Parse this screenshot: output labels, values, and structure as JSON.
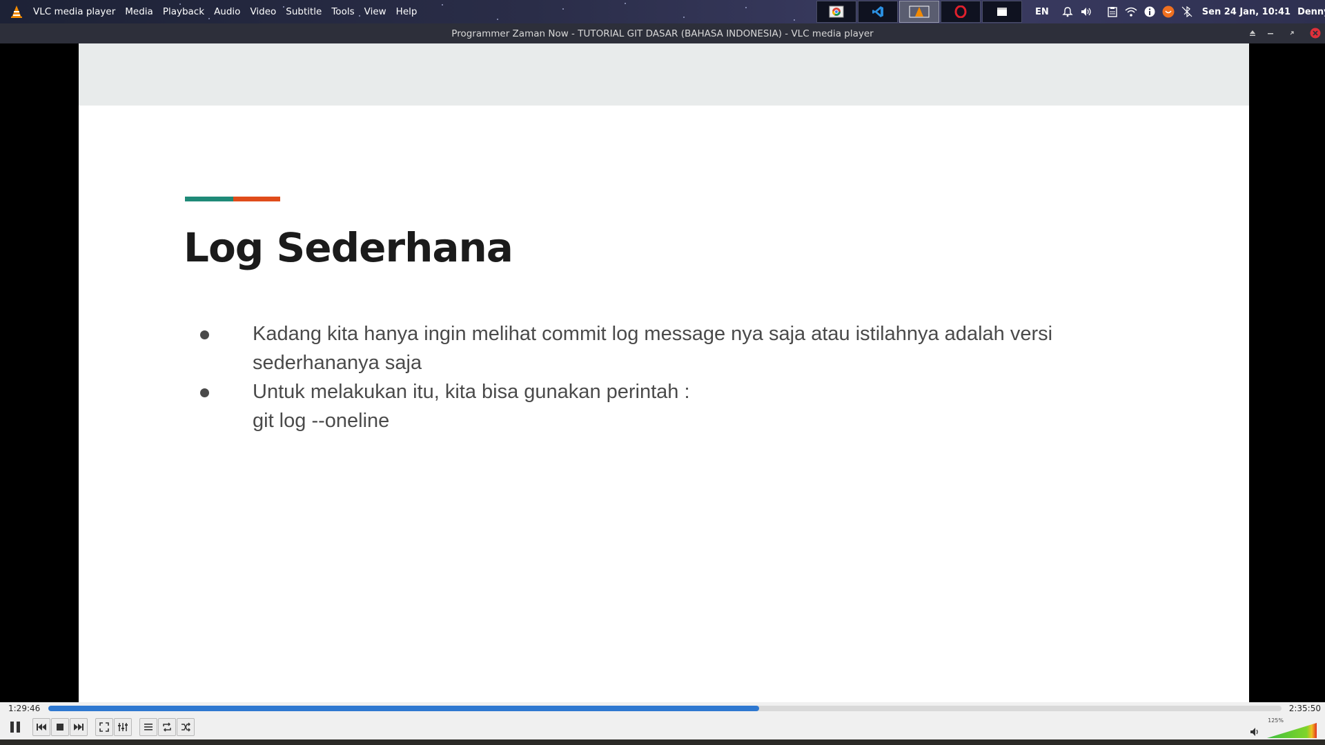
{
  "top_panel": {
    "app_name": "VLC media player",
    "menu": [
      "Media",
      "Playback",
      "Audio",
      "Video",
      "Subtitle",
      "Tools",
      "View",
      "Help"
    ],
    "taskbar_icons": [
      "chrome-icon",
      "vscode-icon",
      "vlc-icon",
      "opera-icon",
      "window-icon"
    ],
    "tray": {
      "language": "EN",
      "clock": "Sen 24 Jan, 10:41",
      "user": "DennyZain"
    }
  },
  "window": {
    "title": "Programmer Zaman Now - TUTORIAL GIT DASAR (BAHASA INDONESIA) - VLC media player"
  },
  "slide": {
    "title": "Log Sederhana",
    "bullets": [
      [
        "Kadang kita hanya ingin melihat commit log message nya saja atau istilahnya adalah versi",
        "sederhananya saja"
      ],
      [
        "Untuk melakukan itu, kita bisa gunakan perintah :",
        "git log --oneline"
      ]
    ],
    "accent_colors": [
      "#1f8a78",
      "#e04c1a"
    ]
  },
  "player": {
    "elapsed": "1:29:46",
    "total": "2:35:50",
    "progress_fraction": 0.5766,
    "volume_label": "125%",
    "volume_fraction": 1.0,
    "seek_color": "#2e78d0"
  }
}
